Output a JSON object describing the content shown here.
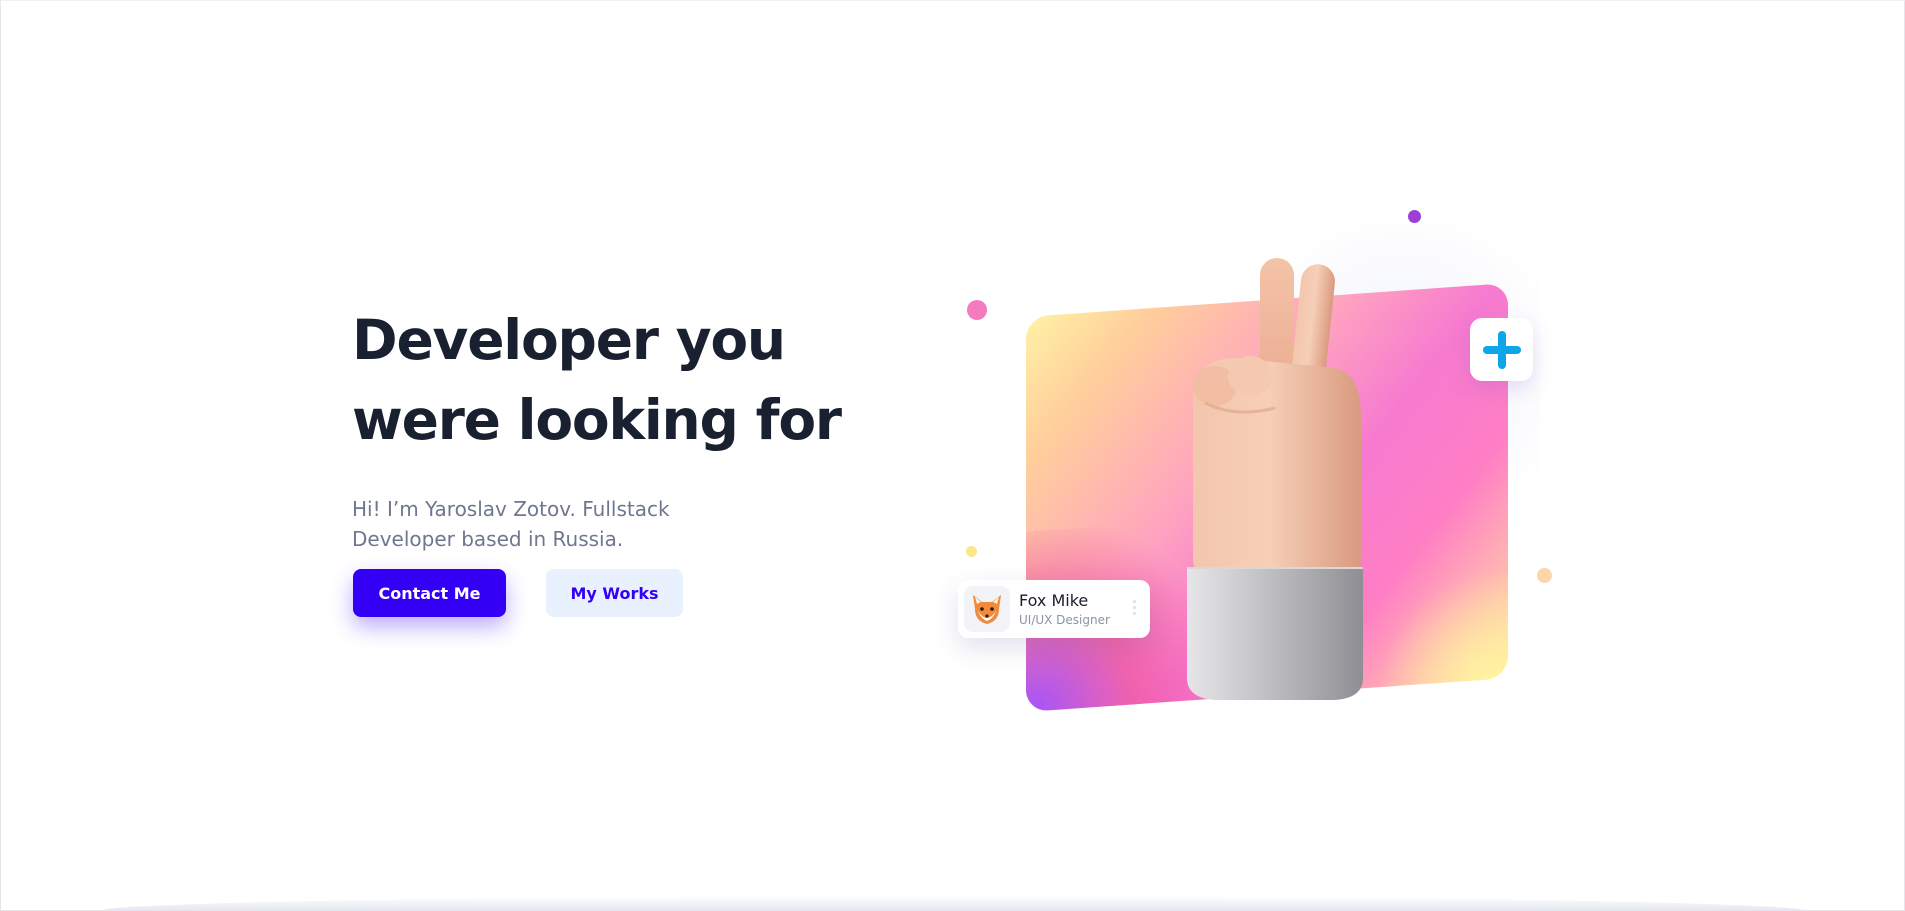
{
  "hero": {
    "title_line1": "Developer you",
    "title_line2": "were looking for",
    "subtitle": "Hi! I’m Yaroslav Zotov. Fullstack Developer based in Russia.",
    "primary_button": "Contact Me",
    "secondary_button": "My Works"
  },
  "illustration": {
    "hand_icon": "peace-sign-hand-icon",
    "plus_icon": "plus-icon",
    "profile": {
      "name": "Fox Mike",
      "role": "UI/UX Designer",
      "avatar_icon": "fox-avatar-icon",
      "menu_icon": "kebab-menu-icon"
    }
  },
  "colors": {
    "title": "#19202f",
    "subtitle": "#6f7790",
    "accent": "#3300f5",
    "secondary_button_bg": "#e8f1fd",
    "plus_icon": "#0ea5e9"
  }
}
